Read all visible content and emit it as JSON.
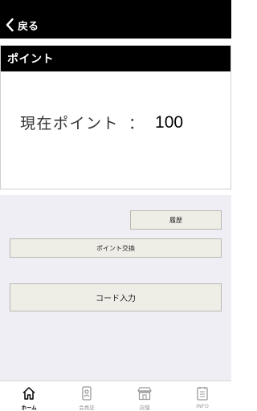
{
  "header": {
    "back_label": "戻る"
  },
  "points_card": {
    "title": "ポイント",
    "label": "現在ポイント",
    "separator": "：",
    "value": "100"
  },
  "actions": {
    "history_label": "履歴",
    "exchange_label": "ポイント交換",
    "code_label": "コード入力"
  },
  "tabbar": {
    "items": [
      {
        "label": "ホーム",
        "icon": "home-icon",
        "active": true
      },
      {
        "label": "会員証",
        "icon": "member-card-icon",
        "active": false
      },
      {
        "label": "店舗",
        "icon": "store-icon",
        "active": false
      },
      {
        "label": "INFO",
        "icon": "info-list-icon",
        "active": false
      }
    ]
  },
  "colors": {
    "header_bg": "#000000",
    "panel_bg": "#efeef4",
    "button_bg": "#eeede6",
    "tab_active": "#000000",
    "tab_inactive": "#999999"
  }
}
